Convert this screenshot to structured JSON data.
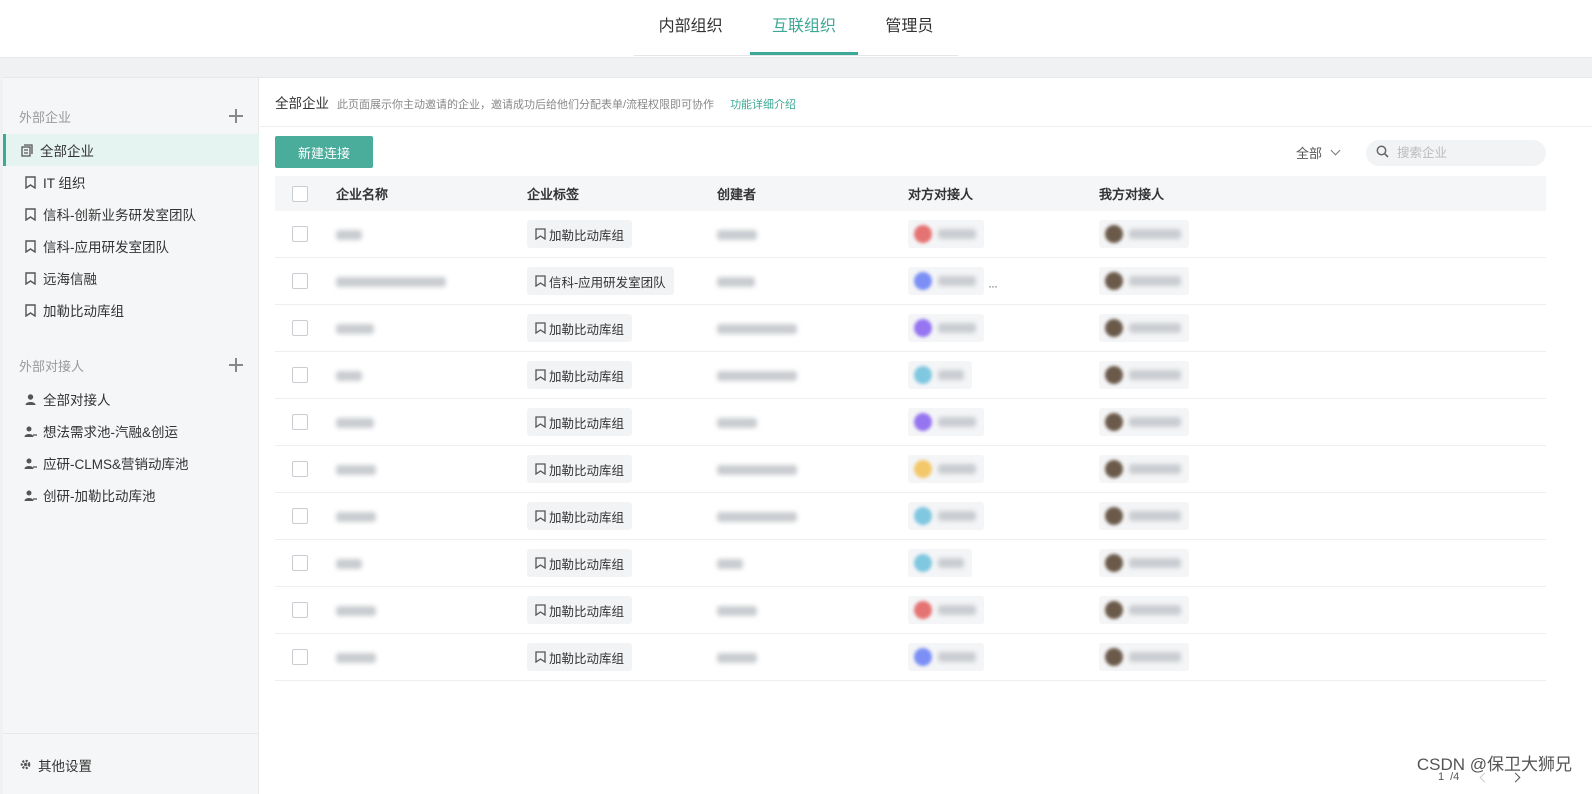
{
  "tabs": [
    {
      "label": "内部组织",
      "active": false
    },
    {
      "label": "互联组织",
      "active": true
    },
    {
      "label": "管理员",
      "active": false
    }
  ],
  "accent_color": "#3ea896",
  "sidebar": {
    "enterprise_section": "外部企业",
    "enterprise_items": [
      {
        "label": "全部企业",
        "icon": "enterprises-icon"
      },
      {
        "label": "IT 组织",
        "icon": "bookmark-icon"
      },
      {
        "label": "信科-创新业务研发室团队",
        "icon": "bookmark-icon"
      },
      {
        "label": "信科-应用研发室团队",
        "icon": "bookmark-icon"
      },
      {
        "label": "远海信融",
        "icon": "bookmark-icon"
      },
      {
        "label": "加勒比动库组",
        "icon": "bookmark-icon"
      }
    ],
    "contact_section": "外部对接人",
    "contact_items": [
      {
        "label": "全部对接人",
        "icon": "contacts-icon"
      },
      {
        "label": "想法需求池-汽融&创运",
        "icon": "contact-group-icon"
      },
      {
        "label": "应研-CLMS&营销动库池",
        "icon": "contact-group-icon"
      },
      {
        "label": "创研-加勒比动库池",
        "icon": "contact-group-icon"
      }
    ],
    "settings_label": "其他设置"
  },
  "main": {
    "info_title": "全部企业",
    "info_desc": "此页面展示你主动邀请的企业，邀请成功后给他们分配表单/流程权限即可协作",
    "info_link": "功能详细介绍",
    "new_button": "新建连接",
    "filter_label": "全部",
    "search_placeholder": "搜索企业",
    "columns": [
      "企业名称",
      "企业标签",
      "创建者",
      "对方对接人",
      "我方对接人"
    ],
    "rows": [
      {
        "tag": "加勒比动库组",
        "avatar_color": "#e57373",
        "more": false
      },
      {
        "tag": "信科-应用研发室团队",
        "avatar_color": "#7b8ff5",
        "more": true
      },
      {
        "tag": "加勒比动库组",
        "avatar_color": "#9575f0",
        "more": false
      },
      {
        "tag": "加勒比动库组",
        "avatar_color": "#80c8e0",
        "more": false
      },
      {
        "tag": "加勒比动库组",
        "avatar_color": "#9575f0",
        "more": false
      },
      {
        "tag": "加勒比动库组",
        "avatar_color": "#f3c86a",
        "more": false
      },
      {
        "tag": "加勒比动库组",
        "avatar_color": "#80c8e0",
        "more": false
      },
      {
        "tag": "加勒比动库组",
        "avatar_color": "#80c8e0",
        "more": false
      },
      {
        "tag": "加勒比动库组",
        "avatar_color": "#e57373",
        "more": false
      },
      {
        "tag": "加勒比动库组",
        "avatar_color": "#7b8ff5",
        "more": false
      }
    ],
    "pagination": {
      "current": "1",
      "total": "/4"
    }
  },
  "watermark": "CSDN @保卫大狮兄"
}
